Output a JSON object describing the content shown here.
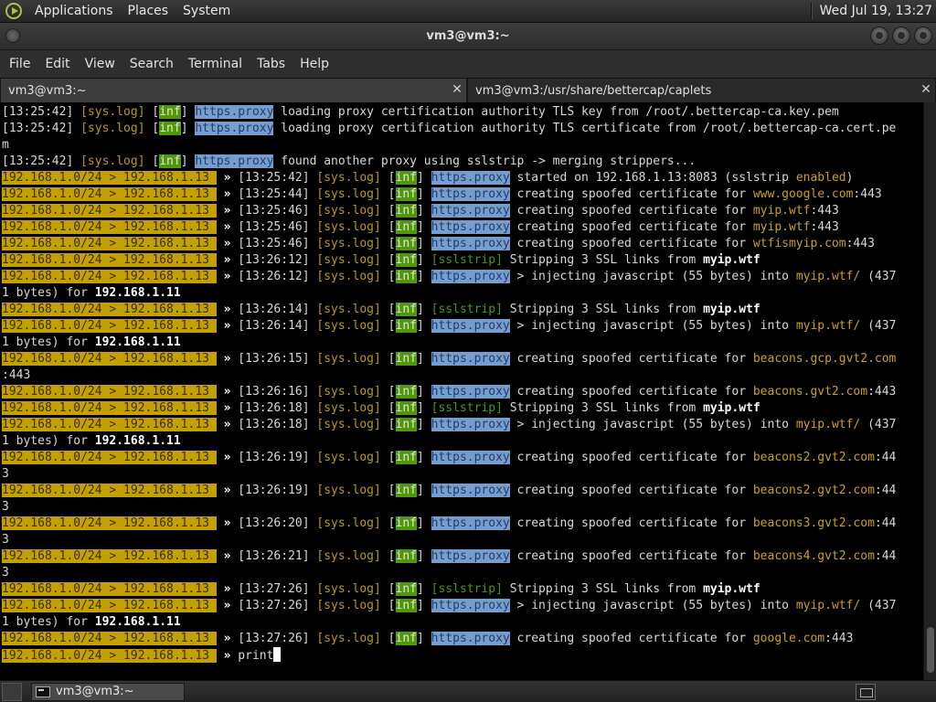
{
  "top_panel": {
    "menus": [
      "Applications",
      "Places",
      "System"
    ],
    "clock": "Wed Jul 19, 13:27"
  },
  "window": {
    "title": "vm3@vm3:~"
  },
  "menubar": [
    "File",
    "Edit",
    "View",
    "Search",
    "Terminal",
    "Tabs",
    "Help"
  ],
  "tabs": [
    {
      "label": "vm3@vm3:~",
      "active": true
    },
    {
      "label": "vm3@vm3:/usr/share/bettercap/caplets",
      "active": false
    }
  ],
  "prompt": "192.168.1.0/24 > 192.168.1.13 ",
  "arrow": "»",
  "terminal_lines": [
    [
      {
        "t": "[13:25:42] "
      },
      {
        "t": "[sys.log]",
        "c": "dim"
      },
      {
        "t": " ["
      },
      {
        "t": "inf",
        "c": "tag-inf"
      },
      {
        "t": "] "
      },
      {
        "t": "https.proxy",
        "c": "tag-proxy"
      },
      {
        "t": " loading proxy certification authority TLS key from /root/.bettercap-ca.key.pem"
      }
    ],
    [
      {
        "t": "[13:25:42] "
      },
      {
        "t": "[sys.log]",
        "c": "dim"
      },
      {
        "t": " ["
      },
      {
        "t": "inf",
        "c": "tag-inf"
      },
      {
        "t": "] "
      },
      {
        "t": "https.proxy",
        "c": "tag-proxy"
      },
      {
        "t": " loading proxy certification authority TLS certificate from /root/.bettercap-ca.cert.pe"
      }
    ],
    [
      {
        "t": "m"
      }
    ],
    [
      {
        "t": "[13:25:42] "
      },
      {
        "t": "[sys.log]",
        "c": "dim"
      },
      {
        "t": " ["
      },
      {
        "t": "inf",
        "c": "tag-inf"
      },
      {
        "t": "] "
      },
      {
        "t": "https.proxy",
        "c": "tag-proxy"
      },
      {
        "t": " found another proxy using sslstrip -> merging strippers..."
      }
    ],
    [
      {
        "p": 1
      },
      {
        "t": " [13:25:42] "
      },
      {
        "t": "[sys.log]",
        "c": "dim"
      },
      {
        "t": " ["
      },
      {
        "t": "inf",
        "c": "tag-inf"
      },
      {
        "t": "] "
      },
      {
        "t": "https.proxy",
        "c": "tag-proxy"
      },
      {
        "t": " started on 192.168.1.13:8083 (sslstrip "
      },
      {
        "t": "enabled",
        "c": "en"
      },
      {
        "t": ")"
      }
    ],
    [
      {
        "p": 1
      },
      {
        "t": " [13:25:44] "
      },
      {
        "t": "[sys.log]",
        "c": "dim"
      },
      {
        "t": " ["
      },
      {
        "t": "inf",
        "c": "tag-inf"
      },
      {
        "t": "] "
      },
      {
        "t": "https.proxy",
        "c": "tag-proxy"
      },
      {
        "t": " creating spoofed certificate for "
      },
      {
        "t": "www.google.com",
        "c": "dom"
      },
      {
        "t": ":443"
      }
    ],
    [
      {
        "p": 1
      },
      {
        "t": " [13:25:46] "
      },
      {
        "t": "[sys.log]",
        "c": "dim"
      },
      {
        "t": " ["
      },
      {
        "t": "inf",
        "c": "tag-inf"
      },
      {
        "t": "] "
      },
      {
        "t": "https.proxy",
        "c": "tag-proxy"
      },
      {
        "t": " creating spoofed certificate for "
      },
      {
        "t": "myip.wtf",
        "c": "dom"
      },
      {
        "t": ":443"
      }
    ],
    [
      {
        "p": 1
      },
      {
        "t": " [13:25:46] "
      },
      {
        "t": "[sys.log]",
        "c": "dim"
      },
      {
        "t": " ["
      },
      {
        "t": "inf",
        "c": "tag-inf"
      },
      {
        "t": "] "
      },
      {
        "t": "https.proxy",
        "c": "tag-proxy"
      },
      {
        "t": " creating spoofed certificate for "
      },
      {
        "t": "myip.wtf",
        "c": "dom"
      },
      {
        "t": ":443"
      }
    ],
    [
      {
        "p": 1
      },
      {
        "t": " [13:25:46] "
      },
      {
        "t": "[sys.log]",
        "c": "dim"
      },
      {
        "t": " ["
      },
      {
        "t": "inf",
        "c": "tag-inf"
      },
      {
        "t": "] "
      },
      {
        "t": "https.proxy",
        "c": "tag-proxy"
      },
      {
        "t": " creating spoofed certificate for "
      },
      {
        "t": "wtfismyip.com",
        "c": "dom"
      },
      {
        "t": ":443"
      }
    ],
    [
      {
        "p": 1
      },
      {
        "t": " [13:26:12] "
      },
      {
        "t": "[sys.log]",
        "c": "dim"
      },
      {
        "t": " ["
      },
      {
        "t": "inf",
        "c": "tag-inf"
      },
      {
        "t": "] "
      },
      {
        "t": "[sslstrip]",
        "c": "tag-ssl"
      },
      {
        "t": " Stripping 3 SSL links from "
      },
      {
        "t": "myip.wtf",
        "c": "bold"
      }
    ],
    [
      {
        "p": 1
      },
      {
        "t": " [13:26:12] "
      },
      {
        "t": "[sys.log]",
        "c": "dim"
      },
      {
        "t": " ["
      },
      {
        "t": "inf",
        "c": "tag-inf"
      },
      {
        "t": "] "
      },
      {
        "t": "https.proxy",
        "c": "tag-proxy"
      },
      {
        "t": " > injecting javascript (55 bytes) into "
      },
      {
        "t": "myip.wtf/",
        "c": "dom"
      },
      {
        "t": " (437"
      }
    ],
    [
      {
        "t": "1 bytes) for "
      },
      {
        "t": "192.168.1.11",
        "c": "bold"
      }
    ],
    [
      {
        "p": 1
      },
      {
        "t": " [13:26:14] "
      },
      {
        "t": "[sys.log]",
        "c": "dim"
      },
      {
        "t": " ["
      },
      {
        "t": "inf",
        "c": "tag-inf"
      },
      {
        "t": "] "
      },
      {
        "t": "[sslstrip]",
        "c": "tag-ssl"
      },
      {
        "t": " Stripping 3 SSL links from "
      },
      {
        "t": "myip.wtf",
        "c": "bold"
      }
    ],
    [
      {
        "p": 1
      },
      {
        "t": " [13:26:14] "
      },
      {
        "t": "[sys.log]",
        "c": "dim"
      },
      {
        "t": " ["
      },
      {
        "t": "inf",
        "c": "tag-inf"
      },
      {
        "t": "] "
      },
      {
        "t": "https.proxy",
        "c": "tag-proxy"
      },
      {
        "t": " > injecting javascript (55 bytes) into "
      },
      {
        "t": "myip.wtf/",
        "c": "dom"
      },
      {
        "t": " (437"
      }
    ],
    [
      {
        "t": "1 bytes) for "
      },
      {
        "t": "192.168.1.11",
        "c": "bold"
      }
    ],
    [
      {
        "p": 1
      },
      {
        "t": " [13:26:15] "
      },
      {
        "t": "[sys.log]",
        "c": "dim"
      },
      {
        "t": " ["
      },
      {
        "t": "inf",
        "c": "tag-inf"
      },
      {
        "t": "] "
      },
      {
        "t": "https.proxy",
        "c": "tag-proxy"
      },
      {
        "t": " creating spoofed certificate for "
      },
      {
        "t": "beacons.gcp.gvt2.com",
        "c": "dom"
      }
    ],
    [
      {
        "t": ":443"
      }
    ],
    [
      {
        "p": 1
      },
      {
        "t": " [13:26:16] "
      },
      {
        "t": "[sys.log]",
        "c": "dim"
      },
      {
        "t": " ["
      },
      {
        "t": "inf",
        "c": "tag-inf"
      },
      {
        "t": "] "
      },
      {
        "t": "https.proxy",
        "c": "tag-proxy"
      },
      {
        "t": " creating spoofed certificate for "
      },
      {
        "t": "beacons.gvt2.com",
        "c": "dom"
      },
      {
        "t": ":443"
      }
    ],
    [
      {
        "p": 1
      },
      {
        "t": " [13:26:18] "
      },
      {
        "t": "[sys.log]",
        "c": "dim"
      },
      {
        "t": " ["
      },
      {
        "t": "inf",
        "c": "tag-inf"
      },
      {
        "t": "] "
      },
      {
        "t": "[sslstrip]",
        "c": "tag-ssl"
      },
      {
        "t": " Stripping 3 SSL links from "
      },
      {
        "t": "myip.wtf",
        "c": "bold"
      }
    ],
    [
      {
        "p": 1
      },
      {
        "t": " [13:26:18] "
      },
      {
        "t": "[sys.log]",
        "c": "dim"
      },
      {
        "t": " ["
      },
      {
        "t": "inf",
        "c": "tag-inf"
      },
      {
        "t": "] "
      },
      {
        "t": "https.proxy",
        "c": "tag-proxy"
      },
      {
        "t": " > injecting javascript (55 bytes) into "
      },
      {
        "t": "myip.wtf/",
        "c": "dom"
      },
      {
        "t": " (437"
      }
    ],
    [
      {
        "t": "1 bytes) for "
      },
      {
        "t": "192.168.1.11",
        "c": "bold"
      }
    ],
    [
      {
        "p": 1
      },
      {
        "t": " [13:26:19] "
      },
      {
        "t": "[sys.log]",
        "c": "dim"
      },
      {
        "t": " ["
      },
      {
        "t": "inf",
        "c": "tag-inf"
      },
      {
        "t": "] "
      },
      {
        "t": "https.proxy",
        "c": "tag-proxy"
      },
      {
        "t": " creating spoofed certificate for "
      },
      {
        "t": "beacons2.gvt2.com",
        "c": "dom"
      },
      {
        "t": ":44"
      }
    ],
    [
      {
        "t": "3"
      }
    ],
    [
      {
        "p": 1
      },
      {
        "t": " [13:26:19] "
      },
      {
        "t": "[sys.log]",
        "c": "dim"
      },
      {
        "t": " ["
      },
      {
        "t": "inf",
        "c": "tag-inf"
      },
      {
        "t": "] "
      },
      {
        "t": "https.proxy",
        "c": "tag-proxy"
      },
      {
        "t": " creating spoofed certificate for "
      },
      {
        "t": "beacons2.gvt2.com",
        "c": "dom"
      },
      {
        "t": ":44"
      }
    ],
    [
      {
        "t": "3"
      }
    ],
    [
      {
        "p": 1
      },
      {
        "t": " [13:26:20] "
      },
      {
        "t": "[sys.log]",
        "c": "dim"
      },
      {
        "t": " ["
      },
      {
        "t": "inf",
        "c": "tag-inf"
      },
      {
        "t": "] "
      },
      {
        "t": "https.proxy",
        "c": "tag-proxy"
      },
      {
        "t": " creating spoofed certificate for "
      },
      {
        "t": "beacons3.gvt2.com",
        "c": "dom"
      },
      {
        "t": ":44"
      }
    ],
    [
      {
        "t": "3"
      }
    ],
    [
      {
        "p": 1
      },
      {
        "t": " [13:26:21] "
      },
      {
        "t": "[sys.log]",
        "c": "dim"
      },
      {
        "t": " ["
      },
      {
        "t": "inf",
        "c": "tag-inf"
      },
      {
        "t": "] "
      },
      {
        "t": "https.proxy",
        "c": "tag-proxy"
      },
      {
        "t": " creating spoofed certificate for "
      },
      {
        "t": "beacons4.gvt2.com",
        "c": "dom"
      },
      {
        "t": ":44"
      }
    ],
    [
      {
        "t": "3"
      }
    ],
    [
      {
        "p": 1
      },
      {
        "t": " [13:27:26] "
      },
      {
        "t": "[sys.log]",
        "c": "dim"
      },
      {
        "t": " ["
      },
      {
        "t": "inf",
        "c": "tag-inf"
      },
      {
        "t": "] "
      },
      {
        "t": "[sslstrip]",
        "c": "tag-ssl"
      },
      {
        "t": " Stripping 3 SSL links from "
      },
      {
        "t": "myip.wtf",
        "c": "bold"
      }
    ],
    [
      {
        "p": 1
      },
      {
        "t": " [13:27:26] "
      },
      {
        "t": "[sys.log]",
        "c": "dim"
      },
      {
        "t": " ["
      },
      {
        "t": "inf",
        "c": "tag-inf"
      },
      {
        "t": "] "
      },
      {
        "t": "https.proxy",
        "c": "tag-proxy"
      },
      {
        "t": " > injecting javascript (55 bytes) into "
      },
      {
        "t": "myip.wtf/",
        "c": "dom"
      },
      {
        "t": " (437"
      }
    ],
    [
      {
        "t": "1 bytes) for "
      },
      {
        "t": "192.168.1.11",
        "c": "bold"
      }
    ],
    [
      {
        "p": 1
      },
      {
        "t": " [13:27:26] "
      },
      {
        "t": "[sys.log]",
        "c": "dim"
      },
      {
        "t": " ["
      },
      {
        "t": "inf",
        "c": "tag-inf"
      },
      {
        "t": "] "
      },
      {
        "t": "https.proxy",
        "c": "tag-proxy"
      },
      {
        "t": " creating spoofed certificate for "
      },
      {
        "t": "google.com",
        "c": "dom"
      },
      {
        "t": ":443"
      }
    ]
  ],
  "input_line": {
    "command": "print"
  },
  "taskbar": {
    "window_label": "vm3@vm3:~"
  }
}
